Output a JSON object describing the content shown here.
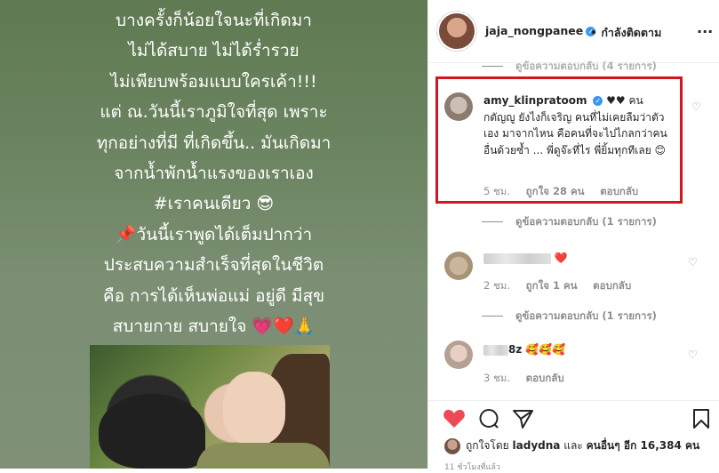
{
  "caption_lines": [
    "บางครั้งก็น้อยใจนะที่เกิดมา",
    "ไม่ได้สบาย ไม่ได้ร่ำรวย",
    "ไม่เพียบพร้อมแบบใครเค้า!!!",
    "แต่ ณ.วันนี้เราภูมิใจที่สุด เพราะ",
    "ทุกอย่างที่มี ที่เกิดขึ้น.. มันเกิดมา",
    "จากน้ำพักน้ำแรงของเราเอง",
    "#เราคนเดียว 😎",
    "📌วันนี้เราพูดได้เต็มปากว่า",
    "ประสบความสำเร็จที่สุดในชีวิต",
    "คือ การได้เห็นพ่อแม่ อยู่ดี มีสุข",
    "สบายกาย สบายใจ 💗❤️🙏"
  ],
  "header": {
    "username": "jaja_nongpanee",
    "follow_label": "• กำลังติดตาม",
    "more_label": "..."
  },
  "comments_top_partial": "ดูข้อความตอบกลับ (4 รายการ)",
  "highlighted_comment": {
    "username": "amy_klinpratoom",
    "text": "♥♥ คนกตัญญู ยังไงก็เจริญ คนที่ไม่เคยลืมว่าตัวเอง มาจากไหน คือคนที่จะไปไกลกว่าคน อื่นด้วยซ้ำ ... พี่ดูจ๊ะที่ไร พี่ยิ้มทุกทีเลย 😊",
    "time": "5 ชม.",
    "likes": "ถูกใจ 28 คน",
    "reply": "ตอบกลับ",
    "view_replies": "ดูข้อความตอบกลับ (1 รายการ)"
  },
  "comment2": {
    "emoji": "❤️",
    "time": "2 ชม.",
    "likes": "ถูกใจ 1 คน",
    "reply": "ตอบกลับ",
    "view_replies": "ดูข้อความตอบกลับ (1 รายการ)"
  },
  "comment3": {
    "username_suffix": "8z",
    "emoji": "🥰🥰🥰",
    "time": "3 ชม.",
    "reply": "ตอบกลับ"
  },
  "likes_line": {
    "prefix": "ถูกใจโดย",
    "user": "ladydna",
    "middle": "และ",
    "others": "คนอื่นๆ อีก 16,384 คน"
  },
  "time_ago": "11 ชั่วโมงที่แล้ว"
}
